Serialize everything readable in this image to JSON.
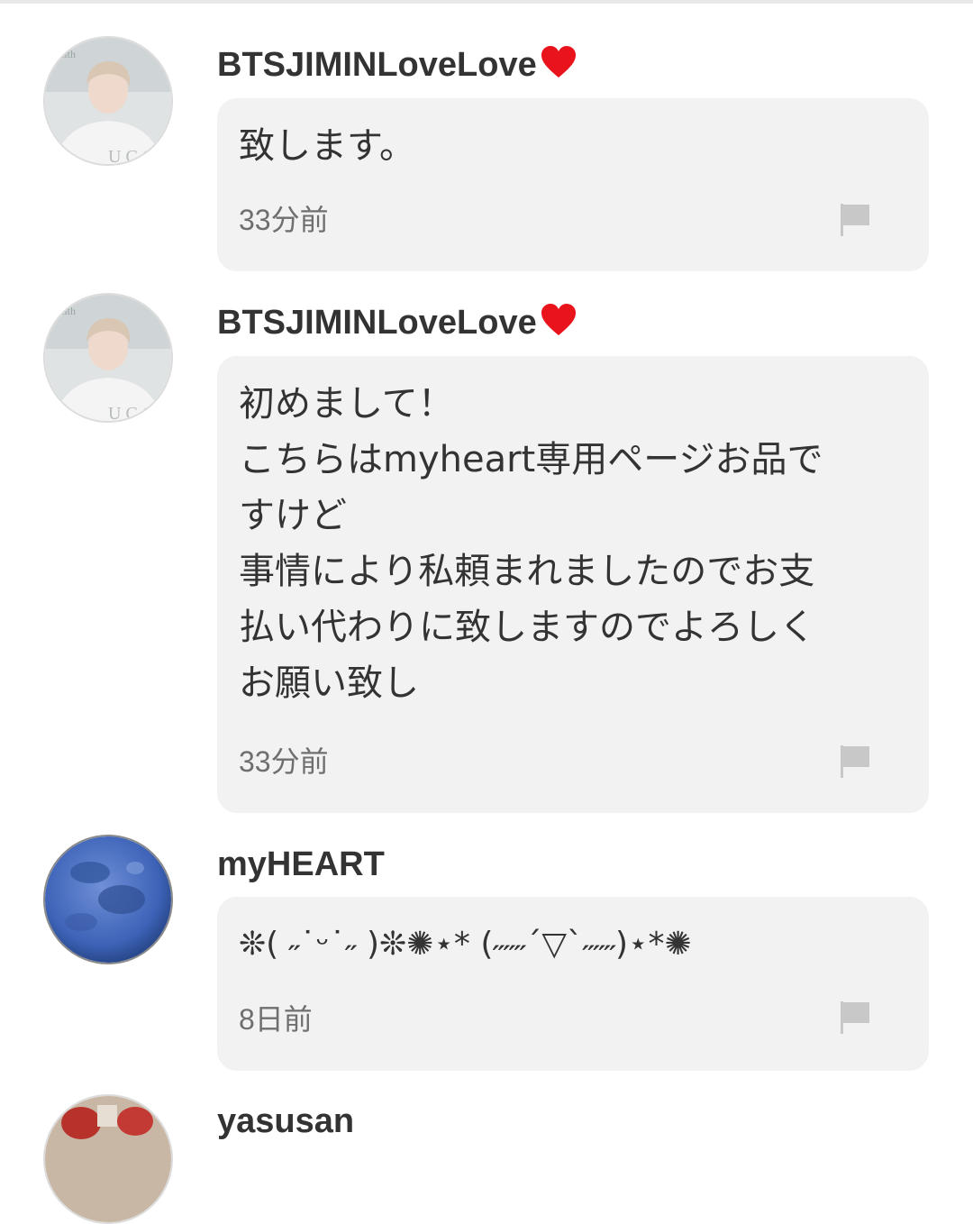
{
  "comments": [
    {
      "username": "BTSJIMINLoveLove",
      "message": "致します。",
      "time": "33分前"
    },
    {
      "username": "BTSJIMINLoveLove",
      "message": "初めまして！\nこちらはmyheart専用ページお品で\nすけど\n事情により私頼まれましたのでお支\n払い代わりに致しますのでよろしく\nお願い致し",
      "time": "33分前"
    },
    {
      "username": "myHEART",
      "message": "❊( ˶˙ᵕ˙˶ )❊✺⋆* (˶˶˶´▽`˶˶˶)⋆*✺",
      "time": "8日前"
    },
    {
      "username": "yasusan"
    }
  ],
  "colors": {
    "heart": "#e8131b",
    "bubble": "#f2f2f2",
    "username": "#333333",
    "time": "#6f6f6f"
  },
  "icons": {
    "report": "flag-icon",
    "heart": "heart-icon"
  }
}
